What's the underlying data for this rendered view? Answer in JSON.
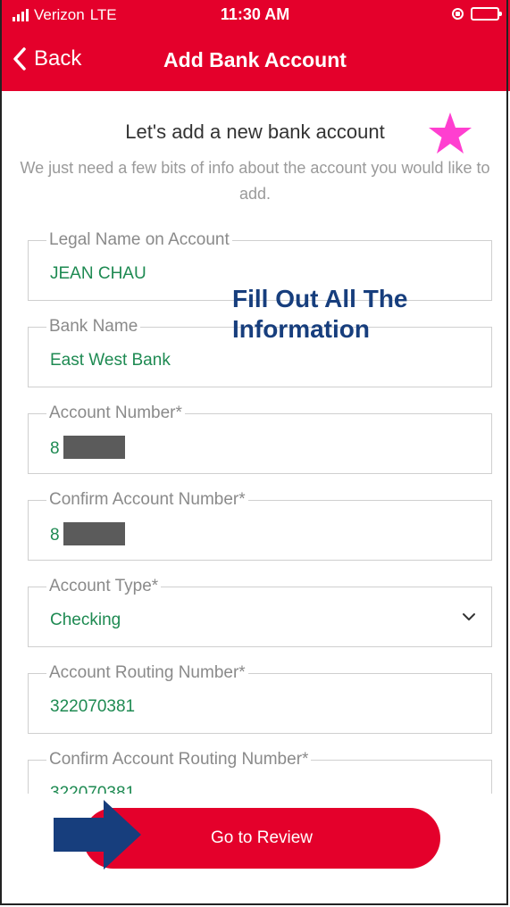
{
  "status_bar": {
    "carrier": "Verizon",
    "network": "LTE",
    "time": "11:30 AM"
  },
  "nav": {
    "back_label": "Back",
    "title": "Add Bank Account"
  },
  "intro": {
    "heading": "Let's add a new bank account",
    "subheading": "We just need a few bits of info about the account you would like to add."
  },
  "annotation": {
    "text": "Fill Out All The Information"
  },
  "fields": {
    "legal_name": {
      "label": "Legal Name on Account",
      "value": "JEAN CHAU"
    },
    "bank_name": {
      "label": "Bank Name",
      "value": "East West Bank"
    },
    "account_number": {
      "label": "Account Number*",
      "value": "8"
    },
    "confirm_account_number": {
      "label": "Confirm Account Number*",
      "value": "8"
    },
    "account_type": {
      "label": "Account Type*",
      "value": "Checking"
    },
    "routing_number": {
      "label": "Account Routing Number*",
      "value": "322070381"
    },
    "confirm_routing_number": {
      "label": "Confirm Account Routing Number*",
      "value": "322070381"
    }
  },
  "actions": {
    "review_label": "Go to Review"
  },
  "colors": {
    "brand": "#e4002b",
    "value_text": "#1e8a52",
    "annotation": "#173e7d",
    "star": "#ff3fd0"
  },
  "icons": [
    "signal-icon",
    "screen-rotation-lock-icon",
    "battery-icon",
    "back-chevron-icon",
    "star-icon",
    "chevron-down-icon",
    "arrow-right-icon"
  ]
}
